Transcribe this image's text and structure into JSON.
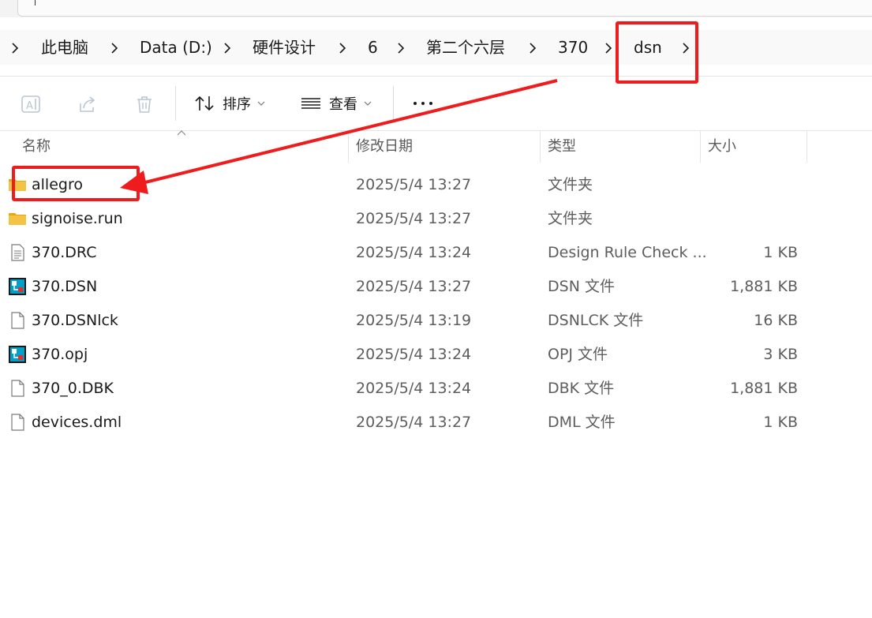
{
  "breadcrumb": {
    "items": [
      "此电脑",
      "Data (D:)",
      "硬件设计",
      "6",
      "第二个六层",
      "370",
      "dsn"
    ]
  },
  "toolbar": {
    "rename_icon": "rename-icon",
    "share_icon": "share-icon",
    "delete_icon": "trash-icon",
    "sort_label": "排序",
    "view_label": "查看",
    "more_icon": "more-icon"
  },
  "columns": {
    "name": "名称",
    "date": "修改日期",
    "type": "类型",
    "size": "大小"
  },
  "files": [
    {
      "name": "allegro",
      "date": "2025/5/4 13:27",
      "type": "文件夹",
      "size": "",
      "icon": "folder-icon"
    },
    {
      "name": "signoise.run",
      "date": "2025/5/4 13:27",
      "type": "文件夹",
      "size": "",
      "icon": "folder-icon"
    },
    {
      "name": "370.DRC",
      "date": "2025/5/4 13:24",
      "type": "Design Rule Check ...",
      "size": "1 KB",
      "icon": "text-file-icon"
    },
    {
      "name": "370.DSN",
      "date": "2025/5/4 13:27",
      "type": "DSN 文件",
      "size": "1,881 KB",
      "icon": "orcad-icon"
    },
    {
      "name": "370.DSNlck",
      "date": "2025/5/4 13:19",
      "type": "DSNLCK 文件",
      "size": "16 KB",
      "icon": "blank-file-icon"
    },
    {
      "name": "370.opj",
      "date": "2025/5/4 13:24",
      "type": "OPJ 文件",
      "size": "3 KB",
      "icon": "orcad-icon"
    },
    {
      "name": "370_0.DBK",
      "date": "2025/5/4 13:24",
      "type": "DBK 文件",
      "size": "1,881 KB",
      "icon": "blank-file-icon"
    },
    {
      "name": "devices.dml",
      "date": "2025/5/4 13:27",
      "type": "DML 文件",
      "size": "1 KB",
      "icon": "blank-file-icon"
    }
  ],
  "colors": {
    "annotation": "#ee1c1c",
    "folder": "#f4c343"
  }
}
